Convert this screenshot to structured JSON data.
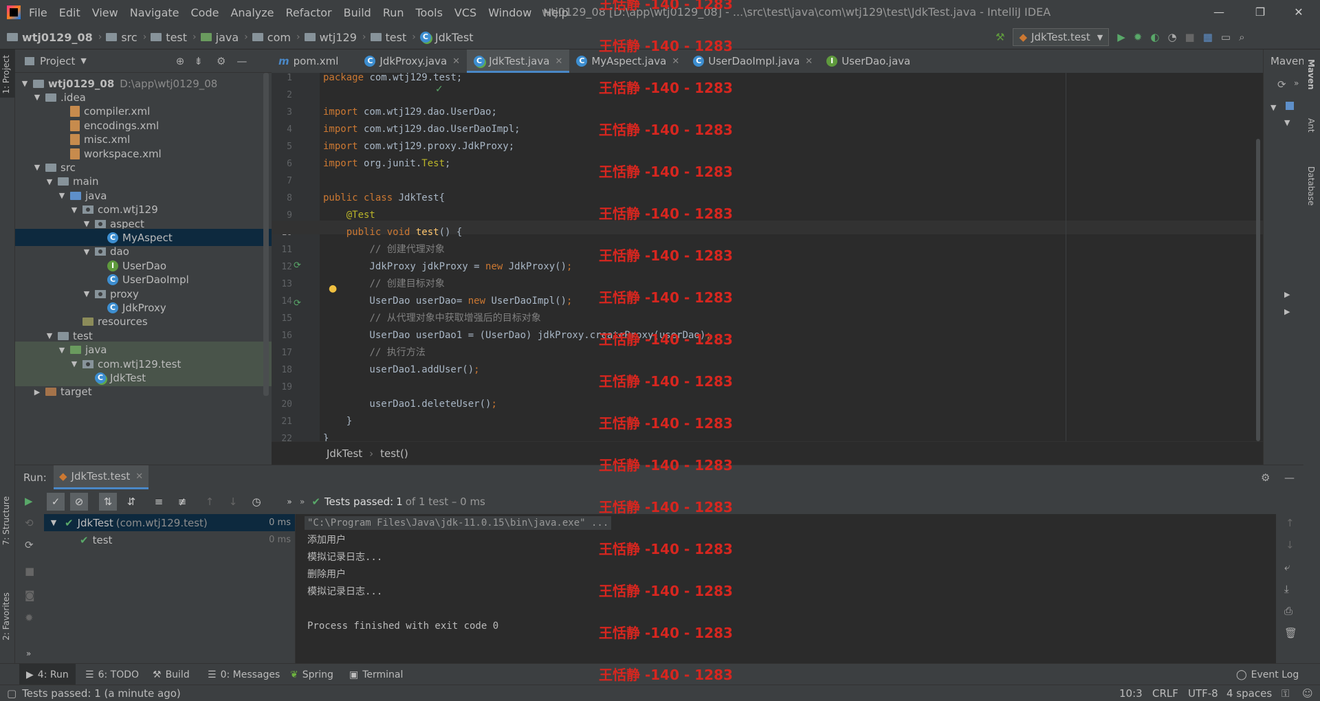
{
  "menu": [
    "File",
    "Edit",
    "View",
    "Navigate",
    "Code",
    "Analyze",
    "Refactor",
    "Build",
    "Run",
    "Tools",
    "VCS",
    "Window",
    "Help"
  ],
  "window_title": "wtj0129_08 [D:\\app\\wtj0129_08] - ...\\src\\test\\java\\com\\wtj129\\test\\JdkTest.java - IntelliJ IDEA",
  "breadcrumb": [
    "wtj0129_08",
    "src",
    "test",
    "java",
    "com",
    "wtj129",
    "test",
    "JdkTest"
  ],
  "run_config": "JdkTest.test",
  "project_panel": {
    "title": "Project"
  },
  "tree": [
    {
      "label": "wtj0129_08",
      "extra": "D:\\app\\wtj0129_08",
      "indent": 0,
      "arrow": "▼",
      "icon": "module-folder"
    },
    {
      "label": ".idea",
      "indent": 1,
      "arrow": "▼",
      "icon": "folder"
    },
    {
      "label": "compiler.xml",
      "indent": 3,
      "arrow": "",
      "icon": "xml"
    },
    {
      "label": "encodings.xml",
      "indent": 3,
      "arrow": "",
      "icon": "xml"
    },
    {
      "label": "misc.xml",
      "indent": 3,
      "arrow": "",
      "icon": "xml"
    },
    {
      "label": "workspace.xml",
      "indent": 3,
      "arrow": "",
      "icon": "xml"
    },
    {
      "label": "src",
      "indent": 1,
      "arrow": "▼",
      "icon": "folder"
    },
    {
      "label": "main",
      "indent": 2,
      "arrow": "▼",
      "icon": "folder"
    },
    {
      "label": "java",
      "indent": 3,
      "arrow": "▼",
      "icon": "blue-folder"
    },
    {
      "label": "com.wtj129",
      "indent": 4,
      "arrow": "▼",
      "icon": "package"
    },
    {
      "label": "aspect",
      "indent": 5,
      "arrow": "▼",
      "icon": "package"
    },
    {
      "label": "MyAspect",
      "indent": 6,
      "arrow": "",
      "icon": "class",
      "selected": true
    },
    {
      "label": "dao",
      "indent": 5,
      "arrow": "▼",
      "icon": "package"
    },
    {
      "label": "UserDao",
      "indent": 6,
      "arrow": "",
      "icon": "interface"
    },
    {
      "label": "UserDaoImpl",
      "indent": 6,
      "arrow": "",
      "icon": "class"
    },
    {
      "label": "proxy",
      "indent": 5,
      "arrow": "▼",
      "icon": "package"
    },
    {
      "label": "JdkProxy",
      "indent": 6,
      "arrow": "",
      "icon": "class"
    },
    {
      "label": "resources",
      "indent": 4,
      "arrow": "",
      "icon": "resources-folder"
    },
    {
      "label": "test",
      "indent": 2,
      "arrow": "▼",
      "icon": "folder"
    },
    {
      "label": "java",
      "indent": 3,
      "arrow": "▼",
      "icon": "green-folder",
      "testbg": true
    },
    {
      "label": "com.wtj129.test",
      "indent": 4,
      "arrow": "▼",
      "icon": "package",
      "testbg": true
    },
    {
      "label": "JdkTest",
      "indent": 5,
      "arrow": "",
      "icon": "test-class",
      "testbg": true
    },
    {
      "label": "target",
      "indent": 1,
      "arrow": "▶",
      "icon": "brown-folder"
    }
  ],
  "editor_tabs": [
    {
      "label": "pom.xml",
      "icon": "m",
      "close": false
    },
    {
      "label": "JdkProxy.java",
      "icon": "c",
      "close": true
    },
    {
      "label": "JdkTest.java",
      "icon": "c",
      "close": true,
      "active": true
    },
    {
      "label": "MyAspect.java",
      "icon": "c",
      "close": true
    },
    {
      "label": "UserDaoImpl.java",
      "icon": "c",
      "close": true
    },
    {
      "label": "UserDao.java",
      "icon": "i",
      "close": false
    }
  ],
  "code": [
    {
      "n": "1",
      "html": "<span class='kw'>package</span> com.wtj129.test;"
    },
    {
      "n": "2",
      "html": ""
    },
    {
      "n": "3",
      "html": "<span class='kw'>import</span> com.wtj129.dao.UserDao;"
    },
    {
      "n": "4",
      "html": "<span class='kw'>import</span> com.wtj129.dao.UserDaoImpl;"
    },
    {
      "n": "5",
      "html": "<span class='kw'>import</span> com.wtj129.proxy.JdkProxy;"
    },
    {
      "n": "6",
      "html": "<span class='kw'>import</span> org.junit.<span class='ann'>Test</span>;"
    },
    {
      "n": "7",
      "html": ""
    },
    {
      "n": "8",
      "html": "<span class='kw'>public class</span> JdkTest{"
    },
    {
      "n": "9",
      "html": "    <span class='ann'>@Test</span>"
    },
    {
      "n": "10",
      "html": "    <span class='kw'>public void</span> <span class='fn'>test</span>() {"
    },
    {
      "n": "11",
      "html": "        <span class='cm'>// 创建代理对象</span>"
    },
    {
      "n": "12",
      "html": "        JdkProxy jdkProxy = <span class='kw'>new</span> JdkProxy()<span class='kw'>;</span>"
    },
    {
      "n": "13",
      "html": "        <span class='cm'>// 创建目标对象</span>"
    },
    {
      "n": "14",
      "html": "        UserDao userDao= <span class='kw'>new</span> UserDaoImpl()<span class='kw'>;</span>"
    },
    {
      "n": "15",
      "html": "        <span class='cm'>// 从代理对象中获取增强后的目标对象</span>"
    },
    {
      "n": "16",
      "html": "        UserDao userDao1 = (UserDao) jdkProxy.createProxy(userDao)<span class='kw'>;</span>"
    },
    {
      "n": "17",
      "html": "        <span class='cm'>// 执行方法</span>"
    },
    {
      "n": "18",
      "html": "        userDao1.addUser()<span class='kw'>;</span>"
    },
    {
      "n": "19",
      "html": ""
    },
    {
      "n": "20",
      "html": "        userDao1.deleteUser()<span class='kw'>;</span>"
    },
    {
      "n": "21",
      "html": "    }"
    },
    {
      "n": "22",
      "html": "}"
    }
  ],
  "editor_breadcrumb": [
    "JdkTest",
    "test()"
  ],
  "maven_label": "Maven",
  "right_strip": [
    "Maven",
    "Ant",
    "Database"
  ],
  "left_strip": [
    "1: Project",
    "7: Structure",
    "2: Favorites"
  ],
  "run": {
    "label": "Run:",
    "tab": "JdkTest.test",
    "status_prefix": "Tests passed:",
    "status_count": "1",
    "status_suffix": "of 1 test – 0 ms",
    "tree": [
      {
        "label": "JdkTest",
        "sub": "(com.wtj129.test)",
        "time": "0 ms"
      },
      {
        "label": "test",
        "sub": "",
        "time": "0 ms"
      }
    ],
    "console": [
      "\"C:\\Program Files\\Java\\jdk-11.0.15\\bin\\java.exe\" ...",
      "添加用户",
      "模拟记录日志...",
      "删除用户",
      "模拟记录日志...",
      "",
      "Process finished with exit code 0"
    ]
  },
  "bottom_tabs": [
    "4: Run",
    "6: TODO",
    "Build",
    "0: Messages",
    "Spring",
    "Terminal"
  ],
  "event_log": "Event Log",
  "status": {
    "message": "Tests passed: 1 (a minute ago)",
    "position": "10:3",
    "line_sep": "CRLF",
    "encoding": "UTF-8",
    "indent": "4 spaces"
  },
  "watermark": "王恬静 -140 - 1283",
  "colors": {
    "accent": "#4a88c7",
    "keyword": "#cc7832",
    "annotation": "#bbb529",
    "comment": "#808080",
    "method": "#ffc66d",
    "watermark": "#d7261f",
    "pass": "#59a869"
  }
}
